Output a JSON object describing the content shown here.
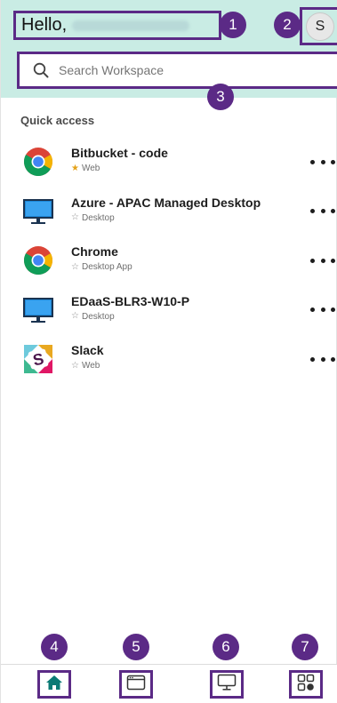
{
  "header": {
    "greeting": "Hello,",
    "avatar_initial": "S"
  },
  "search": {
    "placeholder": "Search Workspace"
  },
  "quick_access": {
    "title": "Quick access",
    "apps": [
      {
        "name": "Bitbucket - code",
        "type": "Web",
        "favorite": true,
        "icon": "chrome-icon"
      },
      {
        "name": "Azure - APAC Managed Desktop",
        "type": "Desktop",
        "favorite": false,
        "icon": "desktop-monitor-icon"
      },
      {
        "name": "Chrome",
        "type": "Desktop App",
        "favorite": false,
        "icon": "chrome-icon"
      },
      {
        "name": "EDaaS-BLR3-W10-P",
        "type": "Desktop",
        "favorite": false,
        "icon": "desktop-monitor-icon"
      },
      {
        "name": "Slack",
        "type": "Web",
        "favorite": false,
        "icon": "slack-icon"
      }
    ]
  },
  "bottom_nav": {
    "items": [
      {
        "icon": "home-icon"
      },
      {
        "icon": "apps-window-icon"
      },
      {
        "icon": "desktops-icon"
      },
      {
        "icon": "grid-more-icon"
      }
    ]
  },
  "callouts": {
    "badge_1": "1",
    "badge_2": "2",
    "badge_3": "3",
    "badge_4": "4",
    "badge_5": "5",
    "badge_6": "6",
    "badge_7": "7"
  },
  "colors": {
    "header_bg": "#c9ece4",
    "callout": "#5b2a86",
    "accent": "#0b7a75",
    "favorite_star": "#e4a21a"
  }
}
